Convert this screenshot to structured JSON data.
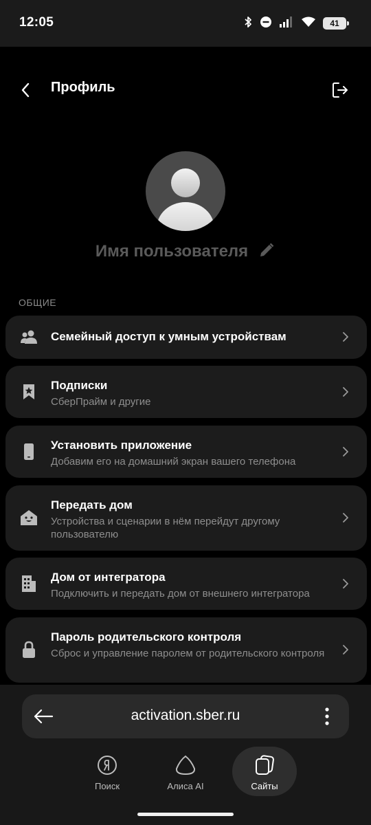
{
  "status_bar": {
    "time": "12:05",
    "battery": "41"
  },
  "header": {
    "title": "Профиль"
  },
  "profile": {
    "username": "Имя пользователя"
  },
  "section": {
    "label": "ОБЩИЕ"
  },
  "items": [
    {
      "title": "Семейный доступ к умным устройствам",
      "subtitle": "",
      "icon": "family-icon"
    },
    {
      "title": "Подписки",
      "subtitle": "СберПрайм и другие",
      "icon": "bookmark-star-icon"
    },
    {
      "title": "Установить приложение",
      "subtitle": "Добавим его на домашний экран вашего телефона",
      "icon": "phone-icon"
    },
    {
      "title": "Передать дом",
      "subtitle": "Устройства и сценарии в нём перейдут другому пользователю",
      "icon": "home-icon"
    },
    {
      "title": "Дом от интегратора",
      "subtitle": "Подключить и передать дом от внешнего интегратора",
      "icon": "building-icon"
    },
    {
      "title": "Пароль родительского контроля",
      "subtitle": "Сброс и управление паролем от родительского контроля",
      "icon": "lock-icon"
    }
  ],
  "browser": {
    "url": "activation.sber.ru",
    "tabs": [
      {
        "label": "Поиск",
        "icon": "yandex-icon"
      },
      {
        "label": "Алиса AI",
        "icon": "alice-icon"
      },
      {
        "label": "Сайты",
        "icon": "sites-icon",
        "active": true
      }
    ]
  }
}
